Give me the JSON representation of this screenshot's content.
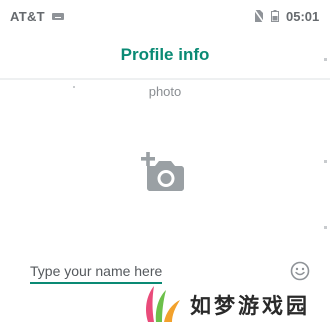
{
  "status_bar": {
    "carrier": "AT&T",
    "time": "05:01",
    "icons": [
      "keyboard-icon",
      "no-sim-icon",
      "battery-icon"
    ]
  },
  "header": {
    "title": "Profile info"
  },
  "photo": {
    "label": "photo",
    "icon": "add-photo-camera-icon"
  },
  "name_field": {
    "placeholder": "Type your name here",
    "value": ""
  },
  "emoji_icon": "emoji-icon",
  "watermark": {
    "text": "如梦游戏园"
  },
  "colors": {
    "accent": "#0a8a74",
    "status_text": "#666a6e",
    "camera_icon": "#9aa0a4",
    "secondary_text": "#8a8e92"
  }
}
